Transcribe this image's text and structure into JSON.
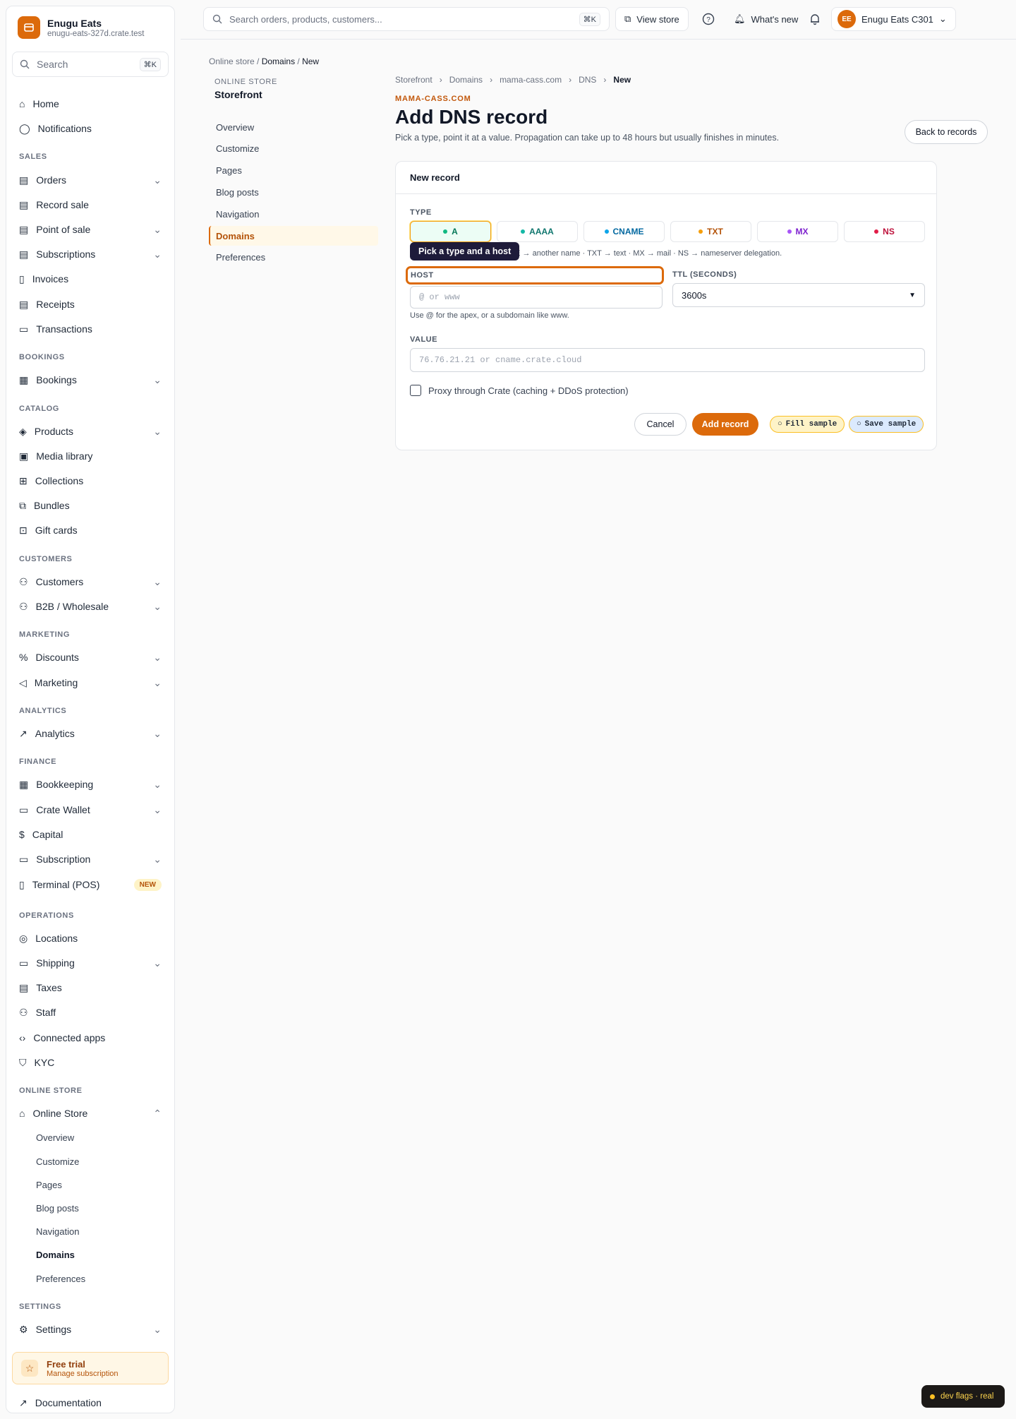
{
  "brand": {
    "name": "Enugu Eats",
    "subdomain": "enugu-eats-327d.crate.test"
  },
  "sidebar": {
    "search": {
      "label": "Search",
      "shortcut": "⌘K"
    },
    "top_items": [
      {
        "label": "Home"
      },
      {
        "label": "Notifications"
      }
    ],
    "sections": {
      "sales": "SALES",
      "bookings": "BOOKINGS",
      "catalog": "CATALOG",
      "customers": "CUSTOMERS",
      "marketing": "MARKETING",
      "analytics": "ANALYTICS",
      "finance": "FINANCE",
      "operations": "OPERATIONS",
      "online_store": "ONLINE STORE",
      "settings": "SETTINGS"
    },
    "items": {
      "orders": "Orders",
      "record_sale": "Record sale",
      "point_of_sale": "Point of sale",
      "subscriptions": "Subscriptions",
      "invoices": "Invoices",
      "receipts": "Receipts",
      "transactions": "Transactions",
      "bookings": "Bookings",
      "products": "Products",
      "media_library": "Media library",
      "collections": "Collections",
      "bundles": "Bundles",
      "gift_cards": "Gift cards",
      "customers": "Customers",
      "b2b": "B2B / Wholesale",
      "discounts": "Discounts",
      "marketing": "Marketing",
      "analytics": "Analytics",
      "bookkeeping": "Bookkeeping",
      "crate_wallet": "Crate Wallet",
      "capital": "Capital",
      "subscription": "Subscription",
      "terminal": "Terminal (POS)",
      "terminal_badge": "NEW",
      "locations": "Locations",
      "shipping": "Shipping",
      "taxes": "Taxes",
      "staff": "Staff",
      "connected_apps": "Connected apps",
      "kyc": "KYC",
      "online_store": "Online Store",
      "settings": "Settings"
    },
    "online_store_sub": [
      "Overview",
      "Customize",
      "Pages",
      "Blog posts",
      "Navigation",
      "Domains",
      "Preferences"
    ],
    "trial": {
      "title": "Free trial",
      "subtitle": "Manage subscription"
    },
    "documentation": "Documentation"
  },
  "topbar": {
    "search_placeholder": "Search orders, products, customers...",
    "search_shortcut": "⌘K",
    "view_store": "View store",
    "whats_new": "What's new",
    "account": {
      "initials": "EE",
      "name": "Enugu Eats C301"
    }
  },
  "breadcrumb_top": {
    "a": "Online store",
    "b": "Domains",
    "c": "New"
  },
  "store_nav": {
    "label": "ONLINE STORE",
    "title": "Storefront",
    "items": [
      "Overview",
      "Customize",
      "Pages",
      "Blog posts",
      "Navigation",
      "Domains",
      "Preferences"
    ]
  },
  "breadcrumb": [
    "Storefront",
    "Domains",
    "mama-cass.com",
    "DNS",
    "New"
  ],
  "page": {
    "domain": "MAMA-CASS.COM",
    "title": "Add DNS record",
    "description": "Pick a type, point it at a value. Propagation can take up to 48 hours but usually finishes in minutes.",
    "back_button": "Back to records"
  },
  "form": {
    "card_title": "New record",
    "type_label": "TYPE",
    "types": [
      {
        "label": "A",
        "color": "#10b981"
      },
      {
        "label": "AAAA",
        "color": "#14b8a6"
      },
      {
        "label": "CNAME",
        "color": "#0ea5e9"
      },
      {
        "label": "TXT",
        "color": "#f59e0b"
      },
      {
        "label": "MX",
        "color": "#a855f7"
      },
      {
        "label": "NS",
        "color": "#e11d48"
      }
    ],
    "selected_type": "A",
    "type_hint": "ME → another name · TXT → text · MX → mail · NS → nameserver delegation.",
    "tooltip": "Pick a type and a host",
    "host_label": "HOST",
    "host_placeholder": "@ or www",
    "host_help": "Use @ for the apex, or a subdomain like www.",
    "ttl_label": "TTL (SECONDS)",
    "ttl_value": "3600s",
    "value_label": "VALUE",
    "value_placeholder": "76.76.21.21 or cname.crate.cloud",
    "proxy_label": "Proxy through Crate (caching + DDoS protection)",
    "cancel": "Cancel",
    "submit": "Add record",
    "fill_sample": "Fill sample",
    "save_sample": "Save sample"
  },
  "dev_flags": "dev flags · real",
  "colors": {
    "accent": "#dc6a0b",
    "tooltip_bg": "#1e1b3a"
  }
}
